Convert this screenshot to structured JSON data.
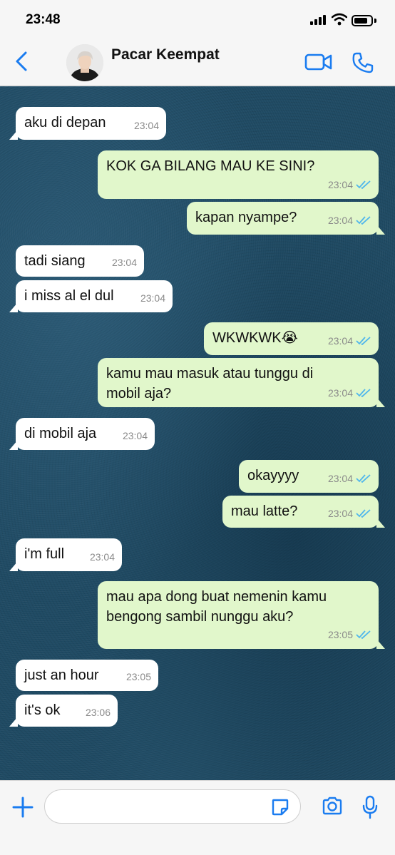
{
  "status_bar": {
    "time": "23:48"
  },
  "header": {
    "contact_name": "Pacar Keempat"
  },
  "messages": [
    {
      "dir": "in",
      "text": "aku di depan",
      "time": "23:04"
    },
    {
      "dir": "out",
      "text": "KOK GA BILANG MAU KE SINI?",
      "time": "23:04"
    },
    {
      "dir": "out",
      "text": "kapan nyampe?",
      "time": "23:04"
    },
    {
      "dir": "in",
      "text": "tadi siang",
      "time": "23:04"
    },
    {
      "dir": "in",
      "text": "i miss al el dul",
      "time": "23:04"
    },
    {
      "dir": "out",
      "text": "WKWKWK😭",
      "time": "23:04"
    },
    {
      "dir": "out",
      "text": "kamu mau masuk atau tunggu di mobil aja?",
      "time": "23:04"
    },
    {
      "dir": "in",
      "text": "di mobil aja",
      "time": "23:04"
    },
    {
      "dir": "out",
      "text": "okayyyy",
      "time": "23:04"
    },
    {
      "dir": "out",
      "text": "mau latte?",
      "time": "23:04"
    },
    {
      "dir": "in",
      "text": "i'm full",
      "time": "23:04"
    },
    {
      "dir": "out",
      "text": "mau apa dong buat nemenin kamu bengong sambil nunggu aku?",
      "time": "23:05"
    },
    {
      "dir": "in",
      "text": "just an hour",
      "time": "23:05"
    },
    {
      "dir": "in",
      "text": "it's ok",
      "time": "23:06"
    }
  ],
  "composer": {
    "placeholder": ""
  },
  "colors": {
    "accent": "#1a7cf0",
    "outgoing_bubble": "#e1f7cb",
    "incoming_bubble": "#ffffff",
    "read_ticks": "#4fb6ec",
    "chat_background": "#1f4a63"
  },
  "icons": [
    "back-chevron-icon",
    "video-call-icon",
    "phone-icon",
    "plus-icon",
    "sticker-icon",
    "camera-icon",
    "microphone-icon",
    "double-check-icon"
  ]
}
